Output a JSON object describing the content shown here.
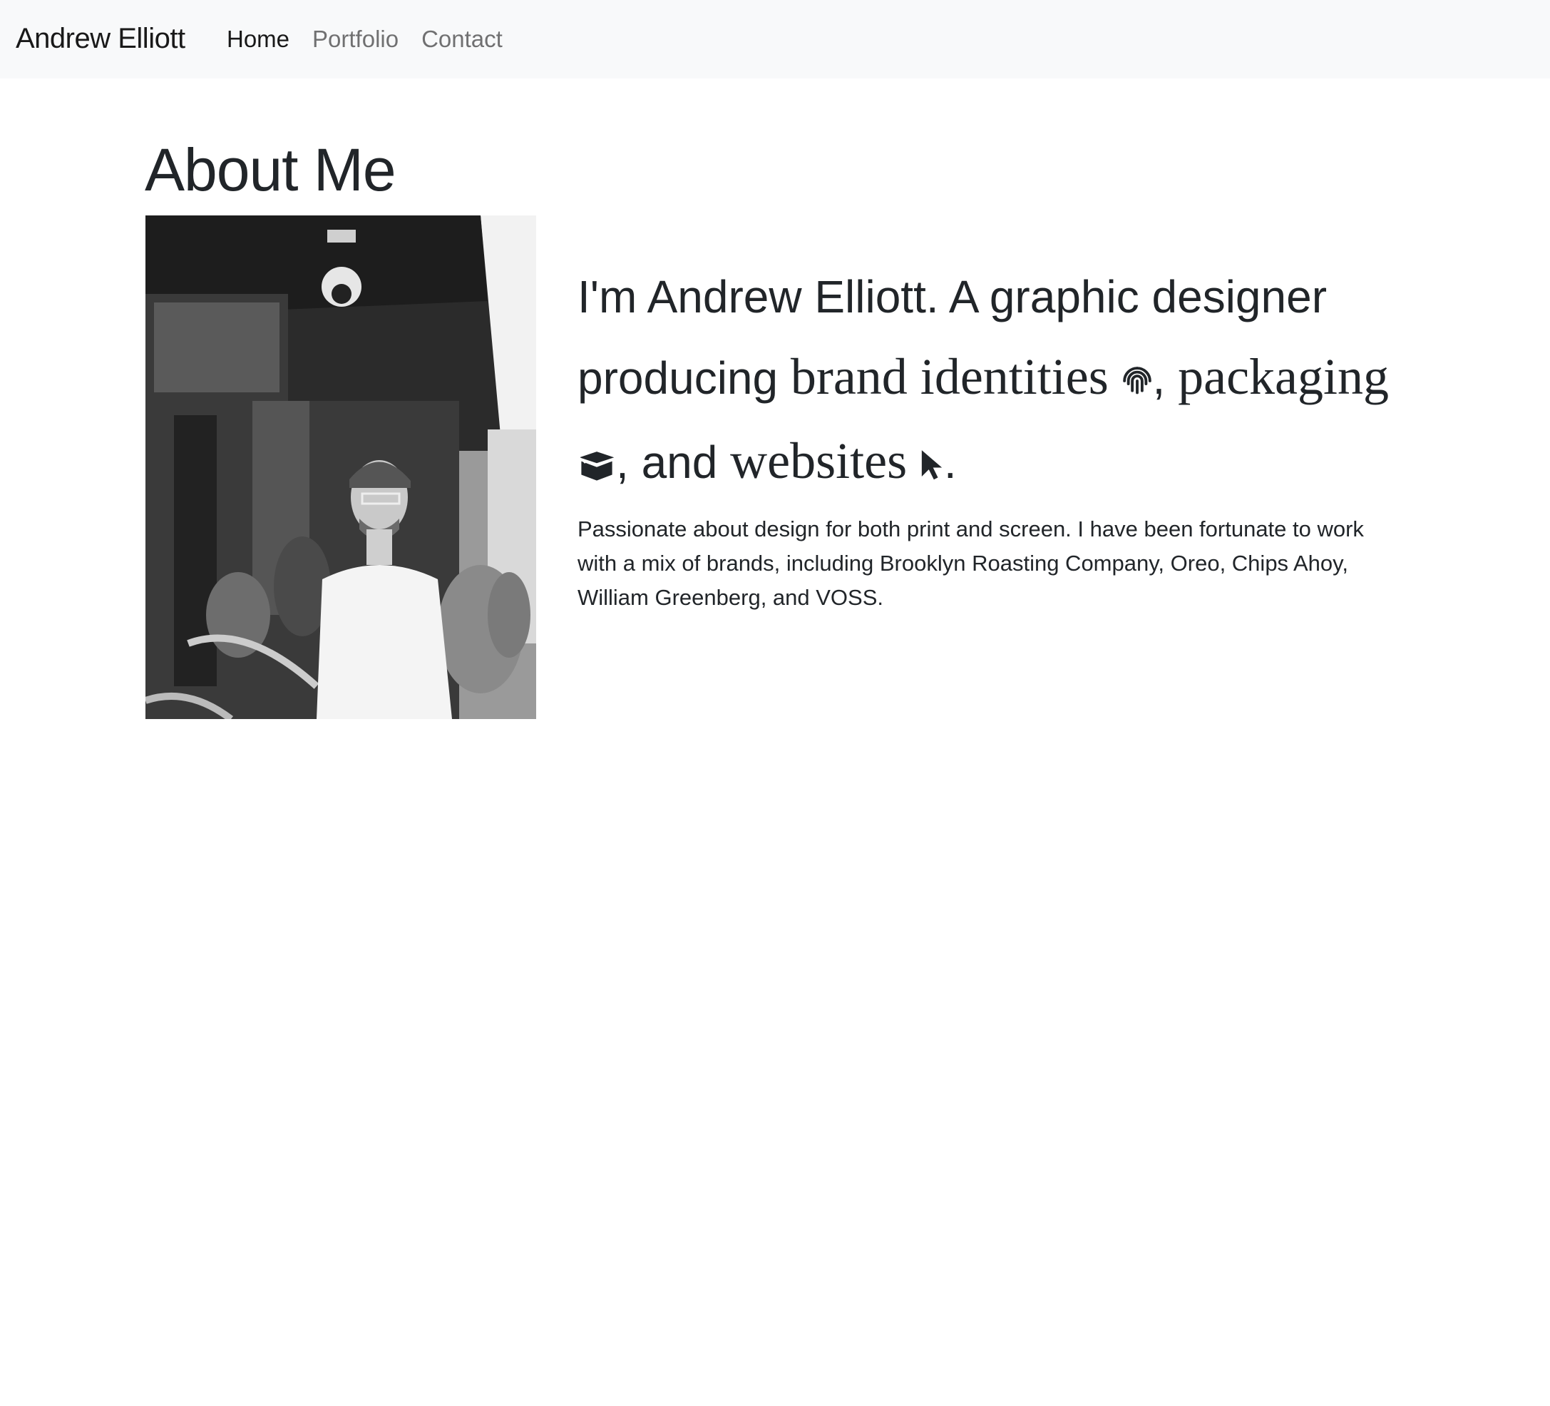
{
  "navbar": {
    "brand": "Andrew Elliott",
    "links": [
      {
        "label": "Home",
        "active": true
      },
      {
        "label": "Portfolio",
        "active": false
      },
      {
        "label": "Contact",
        "active": false
      }
    ]
  },
  "main": {
    "title": "About Me",
    "portrait_alt": "Portrait of Andrew Elliott on a city street",
    "headline": {
      "intro": "I'm Andrew Elliott. A graphic designer producing ",
      "brand_identities": "brand identities",
      "comma1": ",",
      "packaging": "packaging",
      "and": ", and ",
      "websites": "websites",
      "period": "."
    },
    "bio": "Passionate about design for both print and screen. I have been fortunate to work with a mix of brands, including Brooklyn Roasting Company, Oreo, Chips Ahoy, William Greenberg, and VOSS."
  },
  "icons": {
    "brand_identities": "fingerprint-icon",
    "packaging": "box-icon",
    "websites": "cursor-icon"
  }
}
